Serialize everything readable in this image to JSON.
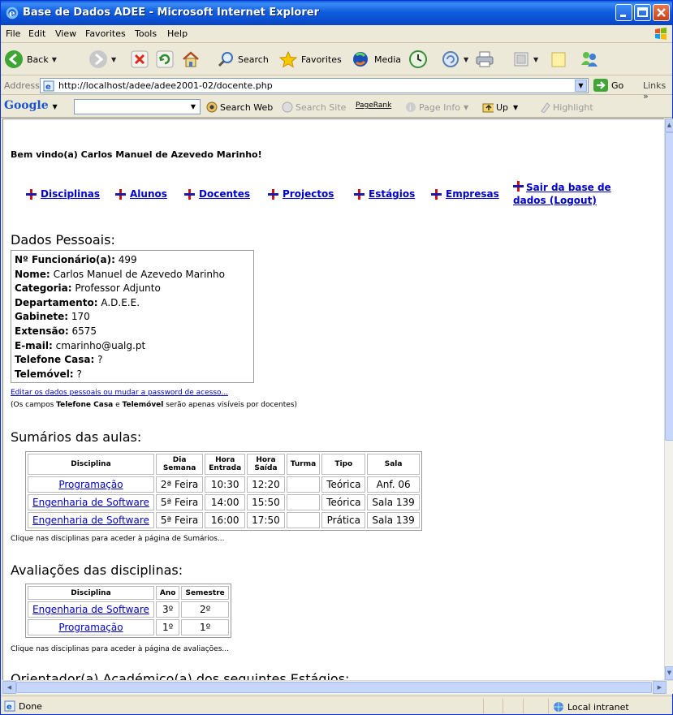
{
  "window": {
    "title": "Base de Dados ADEE - Microsoft Internet Explorer"
  },
  "menu": [
    "File",
    "Edit",
    "View",
    "Favorites",
    "Tools",
    "Help"
  ],
  "toolbar": {
    "back": "Back",
    "search": "Search",
    "favorites": "Favorites",
    "media": "Media"
  },
  "address": {
    "label": "Address",
    "url": "http://localhost/adee/adee2001-02/docente.php",
    "go": "Go",
    "links": "Links"
  },
  "google": {
    "logo": "Google",
    "search_web": "Search Web",
    "search_site": "Search Site",
    "pagerank": "PageRank",
    "page_info": "Page Info",
    "up": "Up",
    "highlight": "Highlight"
  },
  "page": {
    "welcome": "Bem vindo(a) Carlos Manuel de Azevedo Marinho!",
    "nav": [
      "Disciplinas",
      "Alunos",
      "Docentes",
      "Projectos",
      "Estágios",
      "Empresas"
    ],
    "logout_line1": "Sair da base de",
    "logout_line2": "dados (Logout)",
    "personal_heading": "Dados Pessoais:",
    "personal": [
      {
        "label": "Nº Funcionário(a):",
        "value": "499"
      },
      {
        "label": "Nome:",
        "value": "Carlos Manuel de Azevedo Marinho"
      },
      {
        "label": "Categoria:",
        "value": "Professor Adjunto"
      },
      {
        "label": "Departamento:",
        "value": "A.D.E.E."
      },
      {
        "label": "Gabinete:",
        "value": "170"
      },
      {
        "label": "Extensão:",
        "value": "6575"
      },
      {
        "label": "E-mail:",
        "value": "cmarinho@ualg.pt"
      },
      {
        "label": "Telefone Casa:",
        "value": "?"
      },
      {
        "label": "Telemóvel:",
        "value": "?"
      }
    ],
    "edit_link": "Editar os dados pessoais ou mudar a password de acesso...",
    "note_pre": "(Os campos ",
    "note_b1": "Telefone Casa",
    "note_mid": " e ",
    "note_b2": "Telemóvel",
    "note_post": " serão apenas visíveis por docentes)",
    "sumarios_heading": "Sumários das aulas:",
    "sumarios_headers": [
      "Disciplina",
      "Dia Semana",
      "Hora Entrada",
      "Hora Saída",
      "Turma",
      "Tipo",
      "Sala"
    ],
    "sumarios_rows": [
      [
        "Programação",
        "2ª Feira",
        "10:30",
        "12:20",
        "",
        "Teórica",
        "Anf. 06"
      ],
      [
        "Engenharia de Software",
        "5ª Feira",
        "14:00",
        "15:50",
        "",
        "Teórica",
        "Sala 139"
      ],
      [
        "Engenharia de Software",
        "5ª Feira",
        "16:00",
        "17:50",
        "",
        "Prática",
        "Sala 139"
      ]
    ],
    "sumarios_note": "Clique nas disciplinas para aceder à página de Sumários...",
    "avaliacoes_heading": "Avaliações das disciplinas:",
    "avaliacoes_headers": [
      "Disciplina",
      "Ano",
      "Semestre"
    ],
    "avaliacoes_rows": [
      [
        "Engenharia de Software",
        "3º",
        "2º"
      ],
      [
        "Programação",
        "1º",
        "1º"
      ]
    ],
    "avaliacoes_note": "Clique nas disciplinas para aceder à página de avaliações...",
    "orientador_heading": "Orientador(a) Académico(a) dos seguintes Estágios:"
  },
  "status": {
    "text": "Done",
    "zone": "Local intranet"
  }
}
